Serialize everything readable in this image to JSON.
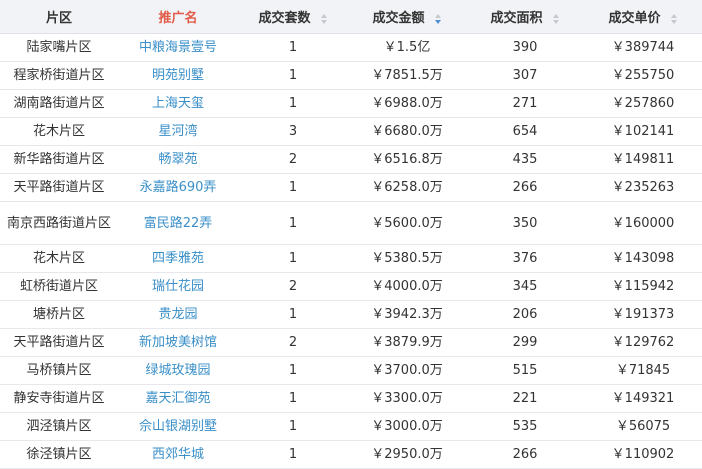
{
  "table": {
    "headers": [
      {
        "label": "片区",
        "sortable": false,
        "active": false
      },
      {
        "label": "推广名",
        "sortable": false,
        "active": true
      },
      {
        "label": "成交套数",
        "sortable": true,
        "sort": "none"
      },
      {
        "label": "成交金额",
        "sortable": true,
        "sort": "desc"
      },
      {
        "label": "成交面积",
        "sortable": true,
        "sort": "none"
      },
      {
        "label": "成交单价",
        "sortable": true,
        "sort": "none"
      }
    ],
    "rows": [
      {
        "area": "陆家嘴片区",
        "name": "中粮海景壹号",
        "units": "1",
        "amount": "￥1.5亿",
        "size": "390",
        "price": "￥389744"
      },
      {
        "area": "程家桥街道片区",
        "name": "明苑别墅",
        "units": "1",
        "amount": "￥7851.5万",
        "size": "307",
        "price": "￥255750"
      },
      {
        "area": "湖南路街道片区",
        "name": "上海天玺",
        "units": "1",
        "amount": "￥6988.0万",
        "size": "271",
        "price": "￥257860"
      },
      {
        "area": "花木片区",
        "name": "星河湾",
        "units": "3",
        "amount": "￥6680.0万",
        "size": "654",
        "price": "￥102141"
      },
      {
        "area": "新华路街道片区",
        "name": "畅翠苑",
        "units": "2",
        "amount": "￥6516.8万",
        "size": "435",
        "price": "￥149811"
      },
      {
        "area": "天平路街道片区",
        "name": "永嘉路690弄",
        "units": "1",
        "amount": "￥6258.0万",
        "size": "266",
        "price": "￥235263"
      },
      {
        "area": "南京西路街道片区",
        "name": "富民路22弄",
        "units": "1",
        "amount": "￥5600.0万",
        "size": "350",
        "price": "￥160000"
      },
      {
        "area": "花木片区",
        "name": "四季雅苑",
        "units": "1",
        "amount": "￥5380.5万",
        "size": "376",
        "price": "￥143098"
      },
      {
        "area": "虹桥街道片区",
        "name": "瑞仕花园",
        "units": "2",
        "amount": "￥4000.0万",
        "size": "345",
        "price": "￥115942"
      },
      {
        "area": "塘桥片区",
        "name": "贵龙园",
        "units": "1",
        "amount": "￥3942.3万",
        "size": "206",
        "price": "￥191373"
      },
      {
        "area": "天平路街道片区",
        "name": "新加坡美树馆",
        "units": "2",
        "amount": "￥3879.9万",
        "size": "299",
        "price": "￥129762"
      },
      {
        "area": "马桥镇片区",
        "name": "绿城玫瑰园",
        "units": "1",
        "amount": "￥3700.0万",
        "size": "515",
        "price": "￥71845"
      },
      {
        "area": "静安寺街道片区",
        "name": "嘉天汇御苑",
        "units": "1",
        "amount": "￥3300.0万",
        "size": "221",
        "price": "￥149321"
      },
      {
        "area": "泗泾镇片区",
        "name": "佘山银湖别墅",
        "units": "1",
        "amount": "￥3000.0万",
        "size": "535",
        "price": "￥56075"
      },
      {
        "area": "徐泾镇片区",
        "name": "西郊华城",
        "units": "1",
        "amount": "￥2950.0万",
        "size": "266",
        "price": "￥110902"
      }
    ]
  },
  "colors": {
    "link": "#3a8fc9",
    "active_header": "#e25a48",
    "sort_active": "#4a90d9",
    "header_bg": "#f1f3f6"
  }
}
